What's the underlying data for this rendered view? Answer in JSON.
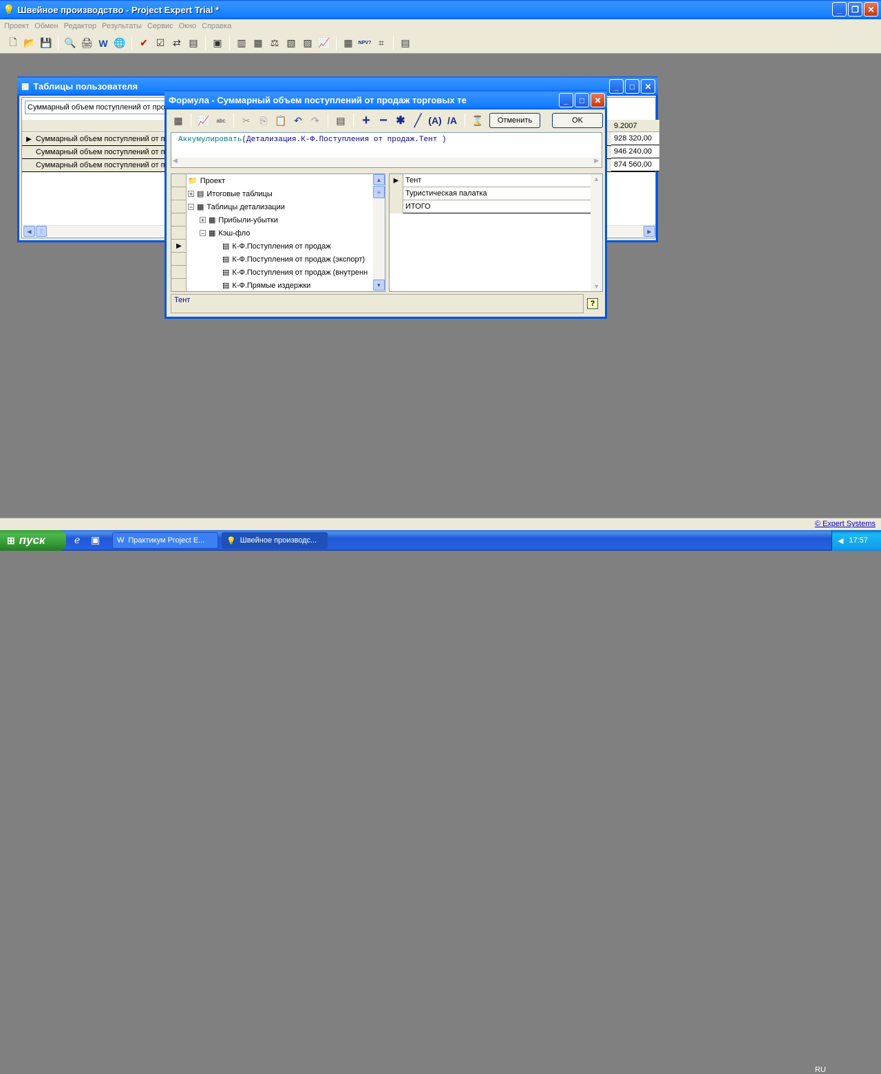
{
  "app": {
    "title": "Швейное производство - Project Expert Trial *"
  },
  "menu": [
    "Проект",
    "Обмен",
    "Редактор",
    "Результаты",
    "Сервис",
    "Окно",
    "Справка"
  ],
  "user_tables": {
    "title": "Таблицы пользователя",
    "combo_value": "Суммарный объем поступлений от прод",
    "rows": [
      {
        "label": "Суммарный объем поступлений от п",
        "value": "928 320,00"
      },
      {
        "label": "Суммарный объем поступлений от п",
        "value": "946 240,00"
      },
      {
        "label": "Суммарный объем поступлений от п",
        "value": "874 560,00"
      }
    ],
    "column_header": "9.2007"
  },
  "formula": {
    "title": "Формула - Суммарный объем поступлений от продаж торговых те",
    "cancel_label": "Отменить",
    "ok_label": "OK",
    "function_name": "Аккумулировать",
    "expression": "(Детализация.К-Ф.Поступления от продаж.Тент )",
    "tree": [
      {
        "label": "Проект",
        "level": 0,
        "expander": ""
      },
      {
        "label": "Итоговые таблицы",
        "level": 1,
        "expander": "+"
      },
      {
        "label": "Таблицы детализации",
        "level": 1,
        "expander": "−"
      },
      {
        "label": "Прибыли-убытки",
        "level": 2,
        "expander": "+"
      },
      {
        "label": "Кэш-фло",
        "level": 2,
        "expander": "−"
      },
      {
        "label": "К-Ф.Поступления от продаж",
        "level": 3,
        "expander": ""
      },
      {
        "label": "К-Ф.Поступления от продаж (экспорт)",
        "level": 3,
        "expander": ""
      },
      {
        "label": "К-Ф.Поступления от продаж (внутренн",
        "level": 3,
        "expander": ""
      },
      {
        "label": "К-Ф.Прямые издержки",
        "level": 3,
        "expander": ""
      }
    ],
    "list": [
      "Тент",
      "Туристическая палатка",
      "ИТОГО"
    ],
    "status": "Тент"
  },
  "status_bar": {
    "link": "© Expert Systems"
  },
  "taskbar": {
    "start": "пуск",
    "tasks": [
      "Практикум Project E...",
      "Швейное производс..."
    ],
    "lang": "RU",
    "time": "17:57"
  }
}
